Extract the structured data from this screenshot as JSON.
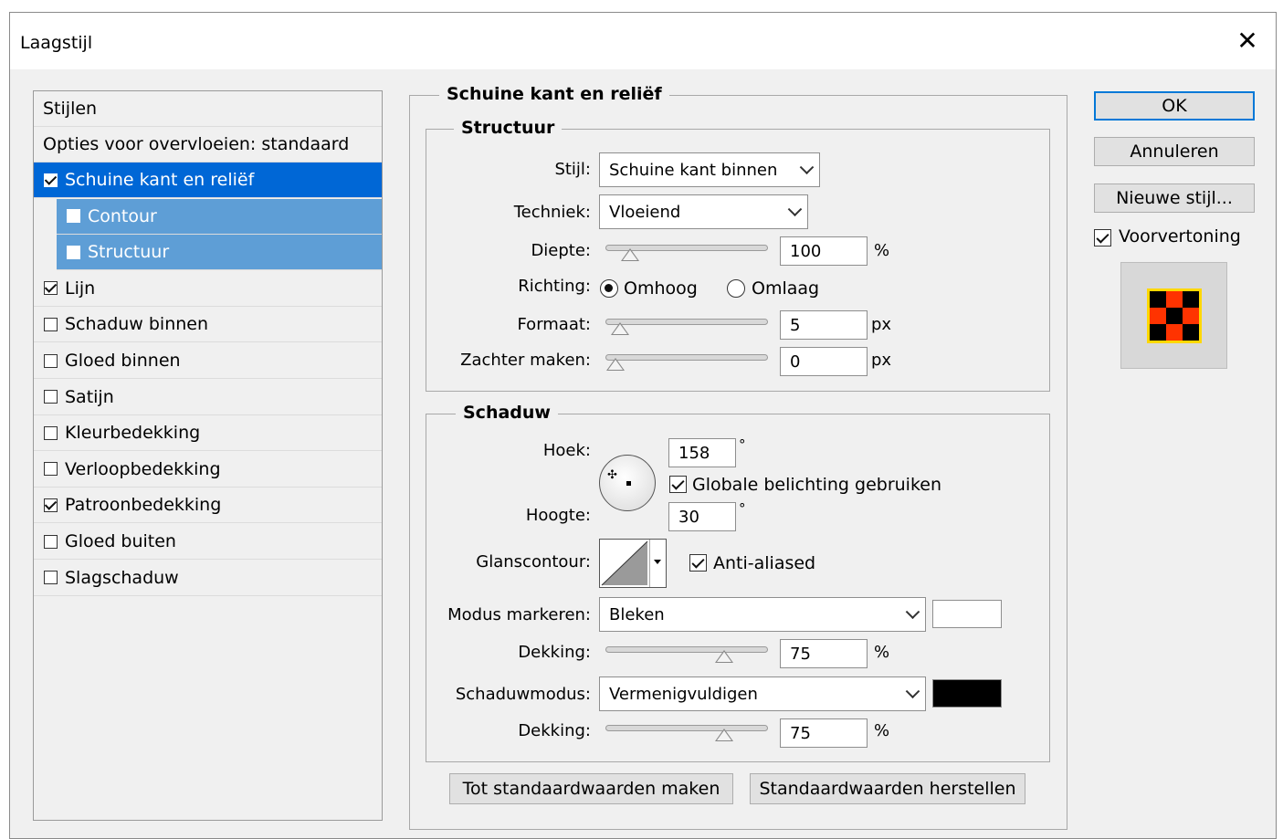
{
  "window": {
    "title": "Laagstijl"
  },
  "styles_panel": {
    "header": "Stijlen",
    "blend_options": "Opties voor overvloeien: standaard",
    "items": [
      {
        "label": "Schuine kant en reliëf",
        "checked": true,
        "state": "selected"
      },
      {
        "label": "Contour",
        "checked": false,
        "state": "sub"
      },
      {
        "label": "Structuur",
        "checked": false,
        "state": "sub"
      },
      {
        "label": "Lijn",
        "checked": true,
        "state": "normal"
      },
      {
        "label": "Schaduw binnen",
        "checked": false,
        "state": "normal"
      },
      {
        "label": "Gloed binnen",
        "checked": false,
        "state": "normal"
      },
      {
        "label": "Satijn",
        "checked": false,
        "state": "normal"
      },
      {
        "label": "Kleurbedekking",
        "checked": false,
        "state": "normal"
      },
      {
        "label": "Verloopbedekking",
        "checked": false,
        "state": "normal"
      },
      {
        "label": "Patroonbedekking",
        "checked": true,
        "state": "normal"
      },
      {
        "label": "Gloed buiten",
        "checked": false,
        "state": "normal"
      },
      {
        "label": "Slagschaduw",
        "checked": false,
        "state": "normal"
      }
    ]
  },
  "bevel": {
    "group_title": "Schuine kant en reliëf",
    "structure": {
      "title": "Structuur",
      "style_label": "Stijl:",
      "style_value": "Schuine kant binnen",
      "technique_label": "Techniek:",
      "technique_value": "Vloeiend",
      "depth_label": "Diepte:",
      "depth_value": "100",
      "depth_unit": "%",
      "depth_slider_fraction": 0.1,
      "direction_label": "Richting:",
      "dir_up": "Omhoog",
      "dir_down": "Omlaag",
      "dir_selected": "Omhoog",
      "size_label": "Formaat:",
      "size_value": "5",
      "size_unit": "px",
      "size_slider_fraction": 0.03,
      "soften_label": "Zachter maken:",
      "soften_value": "0",
      "soften_unit": "px",
      "soften_slider_fraction": 0.0
    },
    "shading": {
      "title": "Schaduw",
      "angle_label": "Hoek:",
      "angle_value": "158",
      "angle_unit": "°",
      "global_light_label": "Globale belichting gebruiken",
      "global_light_checked": true,
      "altitude_label": "Hoogte:",
      "altitude_value": "30",
      "altitude_unit": "°",
      "gloss_label": "Glanscontour:",
      "anti_aliased_label": "Anti-aliased",
      "anti_aliased_checked": true,
      "highlight_mode_label": "Modus markeren:",
      "highlight_mode_value": "Bleken",
      "highlight_color": "#ffffff",
      "highlight_opacity_label": "Dekking:",
      "highlight_opacity_value": "75",
      "highlight_opacity_unit": "%",
      "highlight_opacity_fraction": 0.75,
      "shadow_mode_label": "Schaduwmodus:",
      "shadow_mode_value": "Vermenigvuldigen",
      "shadow_color": "#000000",
      "shadow_opacity_label": "Dekking:",
      "shadow_opacity_value": "75",
      "shadow_opacity_unit": "%",
      "shadow_opacity_fraction": 0.75
    },
    "make_default": "Tot standaardwaarden maken",
    "reset_default": "Standaardwaarden herstellen"
  },
  "buttons": {
    "ok": "OK",
    "cancel": "Annuleren",
    "new_style": "Nieuwe stijl...",
    "preview_label": "Voorvertoning",
    "preview_checked": true
  },
  "colors": {
    "selected": "#0067d6",
    "sub_selected": "#5e9ed6",
    "accent": "#0078d7",
    "preview_fill": "#ff3300"
  }
}
